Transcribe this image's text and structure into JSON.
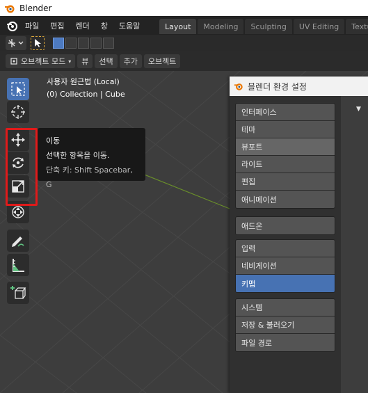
{
  "window": {
    "title": "Blender"
  },
  "menu": {
    "items": [
      "파일",
      "편집",
      "렌더",
      "창",
      "도움말"
    ]
  },
  "workspace_tabs": [
    "Layout",
    "Modeling",
    "Sculpting",
    "UV Editing",
    "Texture"
  ],
  "header2": {
    "mode": "오브젝트 모드",
    "buttons": [
      "뷰",
      "선택",
      "추가",
      "오브젝트"
    ]
  },
  "viewport": {
    "view_label": "사용자 원근법 (Local)",
    "collection_label": "(0) Collection | Cube"
  },
  "tooltip": {
    "title": "이동",
    "description": "선택한 항목을 이동.",
    "shortcut": "단축 키: Shift Spacebar, G"
  },
  "tools": [
    "select-box-icon",
    "cursor-icon",
    "move-icon",
    "rotate-icon",
    "scale-icon",
    "transform-icon",
    "annotate-icon",
    "measure-icon",
    "add-cube-icon"
  ],
  "preferences": {
    "title": "블렌더 환경 설정",
    "groups": [
      [
        "인터페이스",
        "테마",
        "뷰포트",
        "라이트",
        "편집",
        "애니메이션"
      ],
      [
        "애드온"
      ],
      [
        "입력",
        "네비게이션",
        "키맵"
      ],
      [
        "시스템",
        "저장 & 불러오기",
        "파일 경로"
      ]
    ],
    "selected": "키맵",
    "hovered": "뷰포트"
  },
  "colors": {
    "accent": "#4772b3",
    "highlight_box": "#e01a1a"
  }
}
